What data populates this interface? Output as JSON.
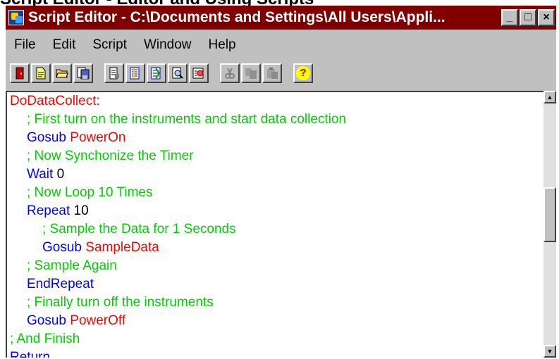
{
  "caption_text": "Script Editor - Editor and Using Scripts",
  "window": {
    "title": "Script Editor - C:\\Documents and Settings\\All Users\\Appli...",
    "minimize_glyph": "_",
    "maximize_glyph": "□",
    "close_glyph": "×"
  },
  "menu": [
    "File",
    "Edit",
    "Script",
    "Window",
    "Help"
  ],
  "toolbar": {
    "groups": [
      [
        "exit-icon",
        "new-icon",
        "open-icon",
        "save-icon"
      ],
      [
        "properties-icon",
        "compile-icon",
        "run-icon",
        "find-icon",
        "trace-icon"
      ],
      [
        "cut-icon-disabled",
        "copy-icon-disabled",
        "paste-icon-disabled"
      ],
      [
        "help-icon"
      ]
    ],
    "help_glyph": "?"
  },
  "colors": {
    "label": "#ff0000",
    "comment": "#00d000",
    "keyword": "#0000ff",
    "plain": "#000000",
    "title_bar": "#800000"
  },
  "code": [
    {
      "indent": 0,
      "tokens": [
        {
          "t": "DoDataCollect:",
          "c": "label"
        }
      ]
    },
    {
      "indent": 1,
      "tokens": [
        {
          "t": "; First turn on the instruments and start data collection",
          "c": "comment"
        }
      ]
    },
    {
      "indent": 1,
      "tokens": [
        {
          "t": "Gosub ",
          "c": "keyword"
        },
        {
          "t": "PowerOn",
          "c": "label"
        }
      ]
    },
    {
      "indent": 1,
      "tokens": [
        {
          "t": "; Now Synchonize the Timer",
          "c": "comment"
        }
      ]
    },
    {
      "indent": 1,
      "tokens": [
        {
          "t": "Wait ",
          "c": "keyword"
        },
        {
          "t": "0",
          "c": "plain"
        }
      ]
    },
    {
      "indent": 1,
      "tokens": [
        {
          "t": "; Now Loop 10 Times",
          "c": "comment"
        }
      ]
    },
    {
      "indent": 1,
      "tokens": [
        {
          "t": "Repeat ",
          "c": "keyword"
        },
        {
          "t": "10",
          "c": "plain"
        }
      ]
    },
    {
      "indent": 2,
      "tokens": [
        {
          "t": "; Sample the Data for 1 Seconds",
          "c": "comment"
        }
      ]
    },
    {
      "indent": 2,
      "tokens": [
        {
          "t": "Gosub ",
          "c": "keyword"
        },
        {
          "t": "SampleData",
          "c": "label"
        }
      ]
    },
    {
      "indent": 1,
      "tokens": [
        {
          "t": "; Sample Again",
          "c": "comment"
        }
      ]
    },
    {
      "indent": 1,
      "tokens": [
        {
          "t": "EndRepeat",
          "c": "keyword"
        }
      ]
    },
    {
      "indent": 1,
      "tokens": [
        {
          "t": "; Finally turn off the instruments",
          "c": "comment"
        }
      ]
    },
    {
      "indent": 1,
      "tokens": [
        {
          "t": "Gosub ",
          "c": "keyword"
        },
        {
          "t": "PowerOff",
          "c": "label"
        }
      ]
    },
    {
      "indent": 0,
      "tokens": [
        {
          "t": "; And Finish",
          "c": "comment"
        }
      ]
    },
    {
      "indent": 0,
      "tokens": [
        {
          "t": "Return",
          "c": "keyword"
        }
      ]
    }
  ],
  "scroll_position": 0.45
}
